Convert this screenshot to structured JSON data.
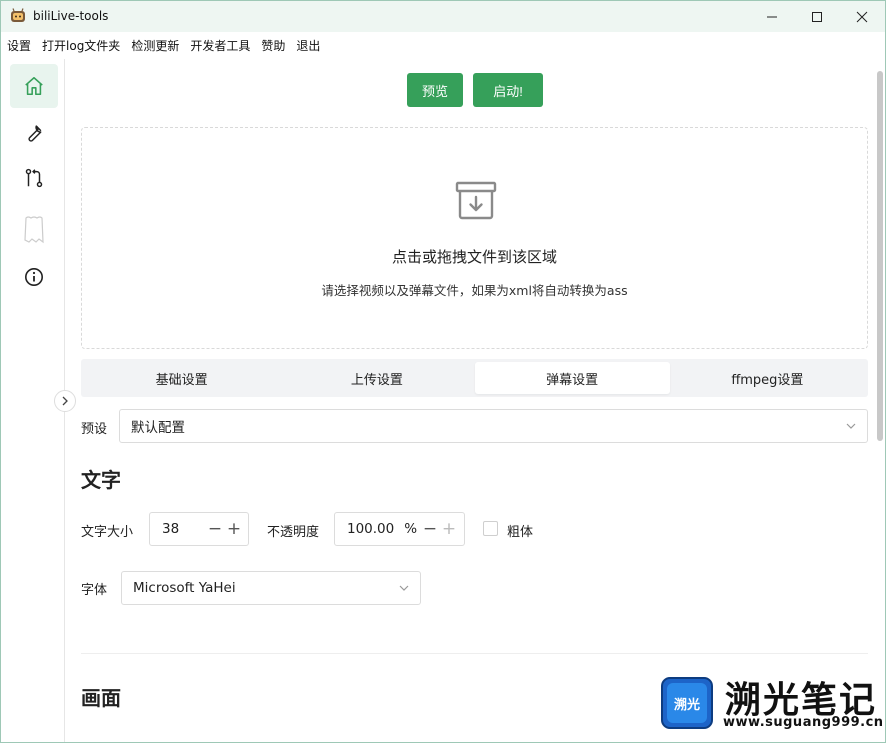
{
  "window": {
    "title": "biliLive-tools"
  },
  "menu": [
    "设置",
    "打开log文件夹",
    "检测更新",
    "开发者工具",
    "赞助",
    "退出"
  ],
  "sidebar": {
    "items": [
      {
        "icon": "home-icon",
        "active": true
      },
      {
        "icon": "wrench-icon",
        "active": false
      },
      {
        "icon": "git-compare-icon",
        "active": false
      },
      {
        "icon": "ghost-icon",
        "active": false
      },
      {
        "icon": "info-icon",
        "active": false
      }
    ]
  },
  "toolbar": {
    "preview_label": "预览",
    "start_label": "启动!"
  },
  "dropzone": {
    "title": "点击或拖拽文件到该区域",
    "hint": "请选择视频以及弹幕文件，如果为xml将自动转换为ass"
  },
  "tabs": [
    {
      "label": "基础设置",
      "active": false
    },
    {
      "label": "上传设置",
      "active": false
    },
    {
      "label": "弹幕设置",
      "active": true
    },
    {
      "label": "ffmpeg设置",
      "active": false
    }
  ],
  "preset": {
    "label": "预设",
    "value": "默认配置"
  },
  "text_section": {
    "title": "文字",
    "size_label": "文字大小",
    "size_value": "38",
    "opacity_label": "不透明度",
    "opacity_value": "100.00",
    "opacity_unit": "%",
    "bold_label": "粗体",
    "bold_checked": false,
    "font_label": "字体",
    "font_value": "Microsoft YaHei"
  },
  "picture_section": {
    "title": "画面"
  },
  "watermark": {
    "logo_text": "溯光",
    "brand": "溯光笔记",
    "url": "www.suguang999.cn"
  },
  "colors": {
    "accent": "#36a05a",
    "titlebar": "#eef6f2",
    "active_side": "#e8f4ee"
  }
}
